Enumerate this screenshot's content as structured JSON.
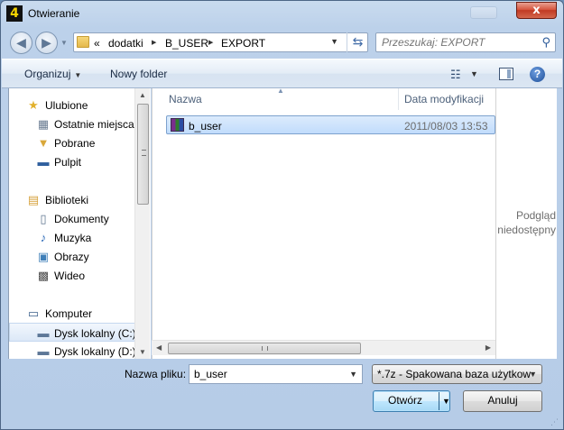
{
  "window": {
    "title": "Otwieranie",
    "app_icon": "4",
    "close_glyph": "x"
  },
  "address": {
    "overflow": "«",
    "crumbs": [
      "dodatki",
      "B_USER",
      "EXPORT"
    ],
    "separator": "▶"
  },
  "search": {
    "placeholder": "Przeszukaj: EXPORT"
  },
  "toolbar": {
    "organize_label": "Organizuj",
    "new_folder_label": "Nowy folder"
  },
  "nav": {
    "items": [
      {
        "label": "Ulubione",
        "icon": "star-icon"
      },
      {
        "label": "Ostatnie miejsca",
        "icon": "recent-places-icon"
      },
      {
        "label": "Pobrane",
        "icon": "downloads-icon"
      },
      {
        "label": "Pulpit",
        "icon": "desktop-icon"
      },
      {
        "label": "Biblioteki",
        "icon": "libraries-icon"
      },
      {
        "label": "Dokumenty",
        "icon": "documents-icon"
      },
      {
        "label": "Muzyka",
        "icon": "music-icon"
      },
      {
        "label": "Obrazy",
        "icon": "pictures-icon"
      },
      {
        "label": "Wideo",
        "icon": "video-icon"
      },
      {
        "label": "Komputer",
        "icon": "computer-icon"
      },
      {
        "label": "Dysk lokalny (C:)",
        "icon": "local-disk-icon"
      },
      {
        "label": "Dysk lokalny (D:)",
        "icon": "local-disk-icon"
      }
    ]
  },
  "files": {
    "columns": {
      "name": "Nazwa",
      "date": "Data modyfikacji"
    },
    "rows": [
      {
        "name": "b_user",
        "date": "2011/08/03 13:53",
        "icon": "archive-icon"
      }
    ]
  },
  "preview": {
    "line1": "Podgląd",
    "line2": "niedostępny"
  },
  "bottom": {
    "filename_label": "Nazwa pliku:",
    "filename_value": "b_user",
    "filetype_value": "*.7z - Spakowana baza użytkow",
    "open_label": "Otwórz",
    "cancel_label": "Anuluj"
  },
  "colors": {
    "selection": "#c1dcfc",
    "accent": "#3c7fb1",
    "close": "#c13a23"
  }
}
